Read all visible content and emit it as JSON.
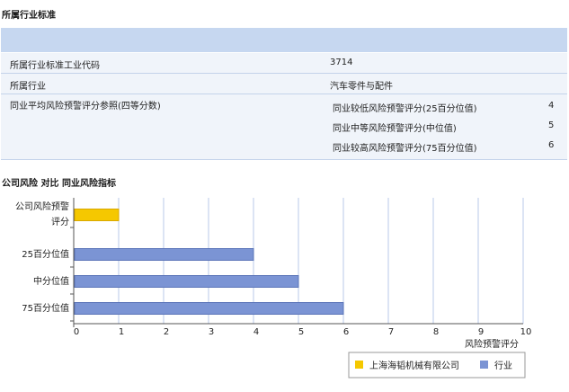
{
  "industry_section": {
    "title": "所属行业标准",
    "rows": [
      {
        "label": "所属行业标准工业代码",
        "value": "3714"
      },
      {
        "label": "所属行业",
        "value": "汽车零件与配件"
      }
    ],
    "peer_score_label": "同业平均风险预警评分参照(四等分数)",
    "peer_scores": [
      {
        "label": "同业较低风险预警评分(25百分位值)",
        "value": "4"
      },
      {
        "label": "同业中等风险预警评分(中位值)",
        "value": "5"
      },
      {
        "label": "同业较高风险预警评分(75百分位值)",
        "value": "6"
      }
    ]
  },
  "chart_section": {
    "title": "公司风险 对比 同业风险指标"
  },
  "colors": {
    "header_band": "#c6d7f0",
    "row_bg": "#f0f4fa",
    "company_bar": "#f5c800",
    "industry_bar": "#7b94d4",
    "grid": "#b8c8e8"
  },
  "chart_data": {
    "type": "bar",
    "orientation": "horizontal",
    "categories": [
      "公司风险预警评分",
      "25百分位值",
      "中分位值",
      "75百分位值"
    ],
    "category_display": [
      [
        "公司风险预警",
        "评分"
      ],
      [
        "25百分位值"
      ],
      [
        "中分位值"
      ],
      [
        "75百分位值"
      ]
    ],
    "series": [
      {
        "name": "上海海韬机械有限公司",
        "values": [
          1,
          null,
          null,
          null
        ],
        "color": "#f5c800"
      },
      {
        "name": "行业",
        "values": [
          null,
          4,
          5,
          6
        ],
        "color": "#7b94d4"
      }
    ],
    "xlabel": "风险预警评分",
    "xlim": [
      0,
      10
    ],
    "xticks": [
      "0",
      "1",
      "2",
      "3",
      "4",
      "5",
      "6",
      "7",
      "8",
      "9",
      "10"
    ],
    "grid": true,
    "legend_position": "bottom-right"
  }
}
